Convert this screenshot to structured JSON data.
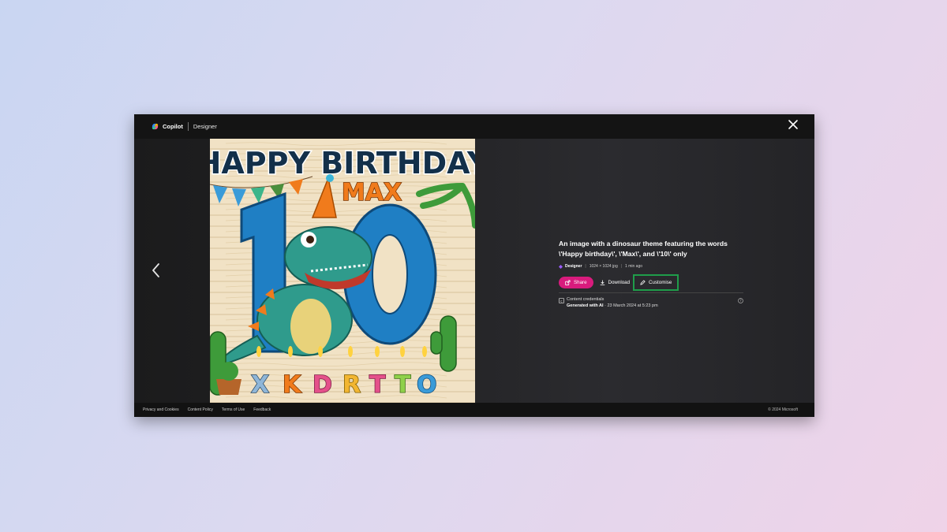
{
  "app": {
    "brand_name": "Copilot",
    "product_name": "Designer"
  },
  "image": {
    "alt": "An image with a dinosaur theme featuring the words \\'Happy birthday\\', \\'Max\\', and \\'10\\' only",
    "art_text": {
      "line1": "HAPPY BIRTHDAY",
      "line2": "MAX",
      "number": "10",
      "candles": [
        "X",
        "K",
        "D",
        "R",
        "T",
        "T",
        "O"
      ]
    }
  },
  "details": {
    "title": "An image with a dinosaur theme featuring the words \\'Happy birthday\\', \\'Max\\', and \\'10\\' only",
    "source": "Designer",
    "dimensions": "1024 × 1024 jpg",
    "time": "1 min ago",
    "share_label": "Share",
    "download_label": "Download",
    "customise_label": "Customise",
    "credentials_title": "Content credentials",
    "credentials_generated": "Generated with AI",
    "credentials_date": " · 23 March 2024 at 5:23 pm"
  },
  "footer": {
    "links": [
      "Privacy and Cookies",
      "Content Policy",
      "Terms of Use",
      "Feedback"
    ],
    "copyright": "© 2024 Microsoft"
  },
  "colors": {
    "share_button": "#d81b7d",
    "highlight_box": "#1f9d4a",
    "window_bg": "#232325"
  }
}
